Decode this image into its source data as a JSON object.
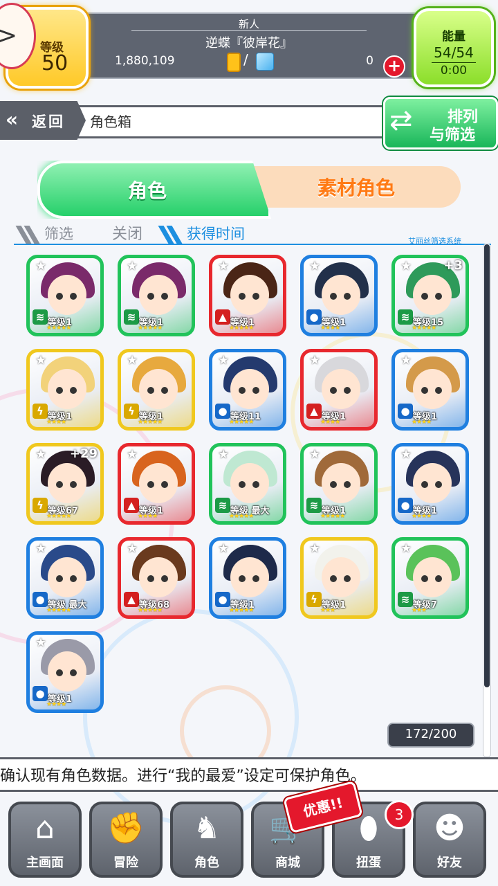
{
  "header": {
    "level_label": "等级",
    "level_value": "50",
    "title_small": "新人",
    "player_name": "逆蝶『彼岸花』",
    "coins": "1,880,109",
    "slash": "/",
    "gems": "0",
    "energy_label": "能量",
    "energy_value": "54/54",
    "energy_timer": "0:00"
  },
  "nav": {
    "back_label": "返回",
    "page_title": "角色箱",
    "sort_line1": "排列",
    "sort_line2": "与筛选"
  },
  "tabs": {
    "characters": "角色",
    "materials": "素材角色"
  },
  "filter": {
    "label": "筛选",
    "state": "关闭",
    "sort_by": "获得时间",
    "system_name": "艾丽丝筛选系统"
  },
  "characters": [
    {
      "level": "等级1",
      "element": "wind",
      "frame": "#21c35a",
      "hair": "#7a2a6a",
      "stars": 5
    },
    {
      "level": "等级1",
      "element": "wind",
      "frame": "#21c35a",
      "hair": "#7a2a6a",
      "stars": 5
    },
    {
      "level": "等级1",
      "element": "fire",
      "frame": "#e8282e",
      "hair": "#4a2516",
      "stars": 5
    },
    {
      "level": "等级1",
      "element": "water",
      "frame": "#1f7fe0",
      "hair": "#22304a",
      "stars": 4
    },
    {
      "level": "等级15",
      "element": "wind",
      "frame": "#21c35a",
      "hair": "#2e9a5a",
      "stars": 5,
      "plus": "+3"
    },
    {
      "level": "等级1",
      "element": "thunder",
      "frame": "#f0c81e",
      "hair": "#f2d27a",
      "stars": 4
    },
    {
      "level": "等级1",
      "element": "thunder",
      "frame": "#f0c81e",
      "hair": "#e7a93e",
      "stars": 5
    },
    {
      "level": "等级11",
      "element": "water",
      "frame": "#1f7fe0",
      "hair": "#243a6e",
      "stars": 5
    },
    {
      "level": "等级1",
      "element": "fire",
      "frame": "#e8282e",
      "hair": "#d8d8dc",
      "stars": 4
    },
    {
      "level": "等级1",
      "element": "water",
      "frame": "#1f7fe0",
      "hair": "#d49a4a",
      "stars": 4
    },
    {
      "level": "等级67",
      "element": "thunder",
      "frame": "#f0c81e",
      "hair": "#2a1c26",
      "stars": 5,
      "plus": "+29"
    },
    {
      "level": "等级1",
      "element": "fire",
      "frame": "#e8282e",
      "hair": "#d8641e",
      "stars": 4
    },
    {
      "level": "等级 最大",
      "element": "wind",
      "frame": "#21c35a",
      "hair": "#bfe8d2",
      "stars": 5
    },
    {
      "level": "等级1",
      "element": "wind",
      "frame": "#21c35a",
      "hair": "#a06a3a",
      "stars": 5
    },
    {
      "level": "等级1",
      "element": "water",
      "frame": "#1f7fe0",
      "hair": "#27335a",
      "stars": 4
    },
    {
      "level": "等级 最大",
      "element": "water",
      "frame": "#1f7fe0",
      "hair": "#2a4a8a",
      "stars": 5
    },
    {
      "level": "等级68",
      "element": "fire",
      "frame": "#e8282e",
      "hair": "#6a3a1e",
      "stars": 5
    },
    {
      "level": "等级1",
      "element": "water",
      "frame": "#1f7fe0",
      "hair": "#1e2a4a",
      "stars": 5
    },
    {
      "level": "等级1",
      "element": "thunder",
      "frame": "#f0c81e",
      "hair": "#f2f2ec",
      "stars": 3
    },
    {
      "level": "等级7",
      "element": "wind",
      "frame": "#21c35a",
      "hair": "#5ac25a",
      "stars": 3
    },
    {
      "level": "等级1",
      "element": "water",
      "frame": "#1f7fe0",
      "hair": "#9a9aa8",
      "stars": 4
    }
  ],
  "box_count": "172/200",
  "hint": "确认现有角色数据。进行“我的最爱”设定可保护角色。",
  "bottom_nav": [
    {
      "label": "主画面",
      "icon": "home-icon",
      "glyph": "⌂"
    },
    {
      "label": "冒险",
      "icon": "handshake-icon",
      "glyph": "✊"
    },
    {
      "label": "角色",
      "icon": "rabbit-icon",
      "glyph": "♞"
    },
    {
      "label": "商城",
      "icon": "cart-icon",
      "glyph": "🛒"
    },
    {
      "label": "扭蛋",
      "icon": "egg-icon",
      "glyph": "⬮"
    },
    {
      "label": "好友",
      "icon": "friends-icon",
      "glyph": "☻"
    }
  ],
  "promo_label": "优惠!!",
  "gacha_badge": "3",
  "colors": {
    "wind": "#1c9a46",
    "fire": "#d42020",
    "water": "#1668c8",
    "thunder": "#d9a800"
  },
  "element_glyphs": {
    "wind": "≋",
    "fire": "▲",
    "water": "●",
    "thunder": "ϟ"
  }
}
